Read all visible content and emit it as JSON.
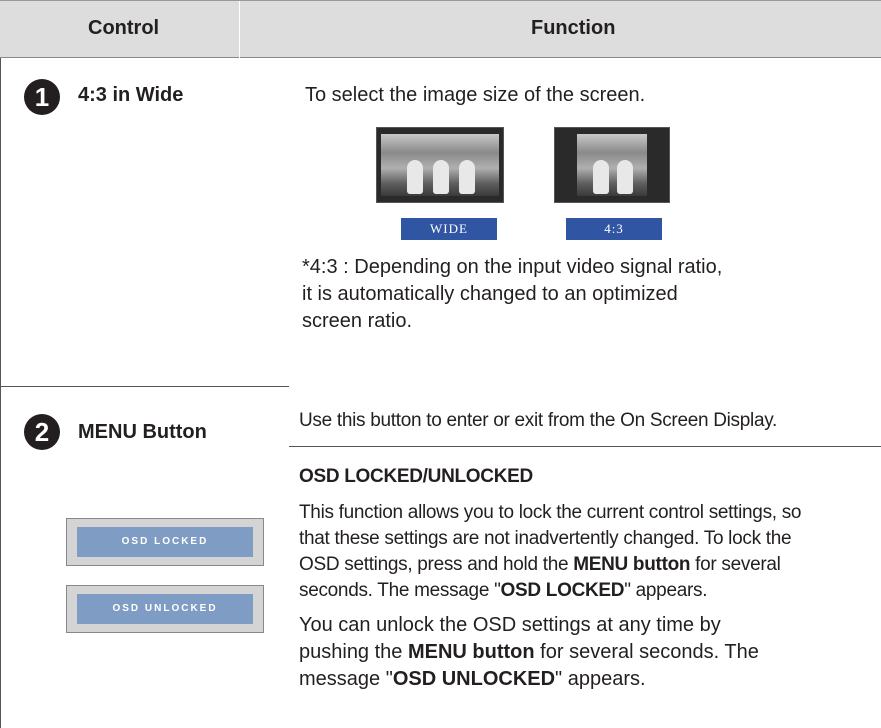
{
  "header": {
    "control": "Control",
    "function": "Function"
  },
  "row1": {
    "number": "1",
    "name": "4:3 in Wide",
    "description": "To select the image size of the screen.",
    "tags": {
      "wide": "WIDE",
      "standard": "4:3"
    },
    "note_lines": [
      "*4:3 : Depending on the input video signal ratio,",
      "it is automatically changed to an optimized",
      "screen ratio."
    ]
  },
  "row2": {
    "number": "2",
    "name": "MENU Button",
    "description": "Use this button to enter or exit from the On Screen Display.",
    "osd_locked_label": "OSD LOCKED",
    "osd_unlocked_label": "OSD UNLOCKED",
    "section_title": "OSD LOCKED/UNLOCKED",
    "para1": {
      "l1": "This function allows you to lock the current control settings, so",
      "l2": "that these settings are not inadvertently changed. To lock the",
      "l3_a": "OSD settings, press and hold the ",
      "l3_b": "MENU button",
      "l3_c": " for several",
      "l4_a": "seconds. The message \"",
      "l4_b": "OSD LOCKED",
      "l4_c": "\" appears."
    },
    "para2": {
      "l1": "You can unlock the OSD settings at any time by",
      "l2_a": "pushing the ",
      "l2_b": "MENU button",
      "l2_c": " for several seconds. The",
      "l3_a": "message \"",
      "l3_b": "OSD UNLOCKED",
      "l3_c": "\" appears."
    }
  }
}
